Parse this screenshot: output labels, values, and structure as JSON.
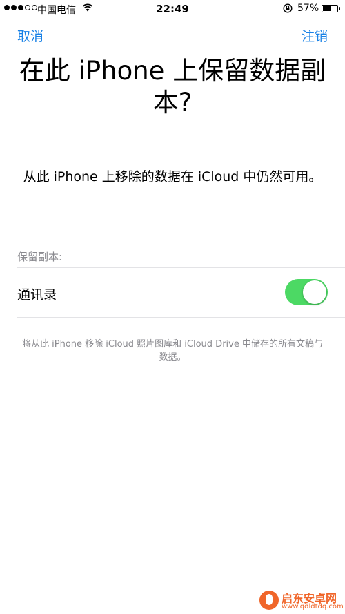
{
  "status_bar": {
    "carrier": "中国电信",
    "time": "22:49",
    "battery_percent": "57%",
    "battery_level": 0.57
  },
  "nav": {
    "cancel_label": "取消",
    "signout_label": "注销"
  },
  "title": "在此 iPhone 上保留数据副本?",
  "subtitle": "从此 iPhone 上移除的数据在 iCloud 中仍然可用。",
  "section": {
    "header": "保留副本:",
    "rows": [
      {
        "label": "通讯录",
        "enabled": true
      }
    ]
  },
  "footer": "将从此 iPhone 移除 iCloud 照片图库和 iCloud Drive 中储存的所有文稿与数据。",
  "watermark": {
    "brand": "启东安卓网",
    "url": "www.qdldtdq.com"
  },
  "colors": {
    "accent": "#1a82e6",
    "toggle_on": "#4cd964",
    "secondary_text": "#8a8a8f"
  }
}
